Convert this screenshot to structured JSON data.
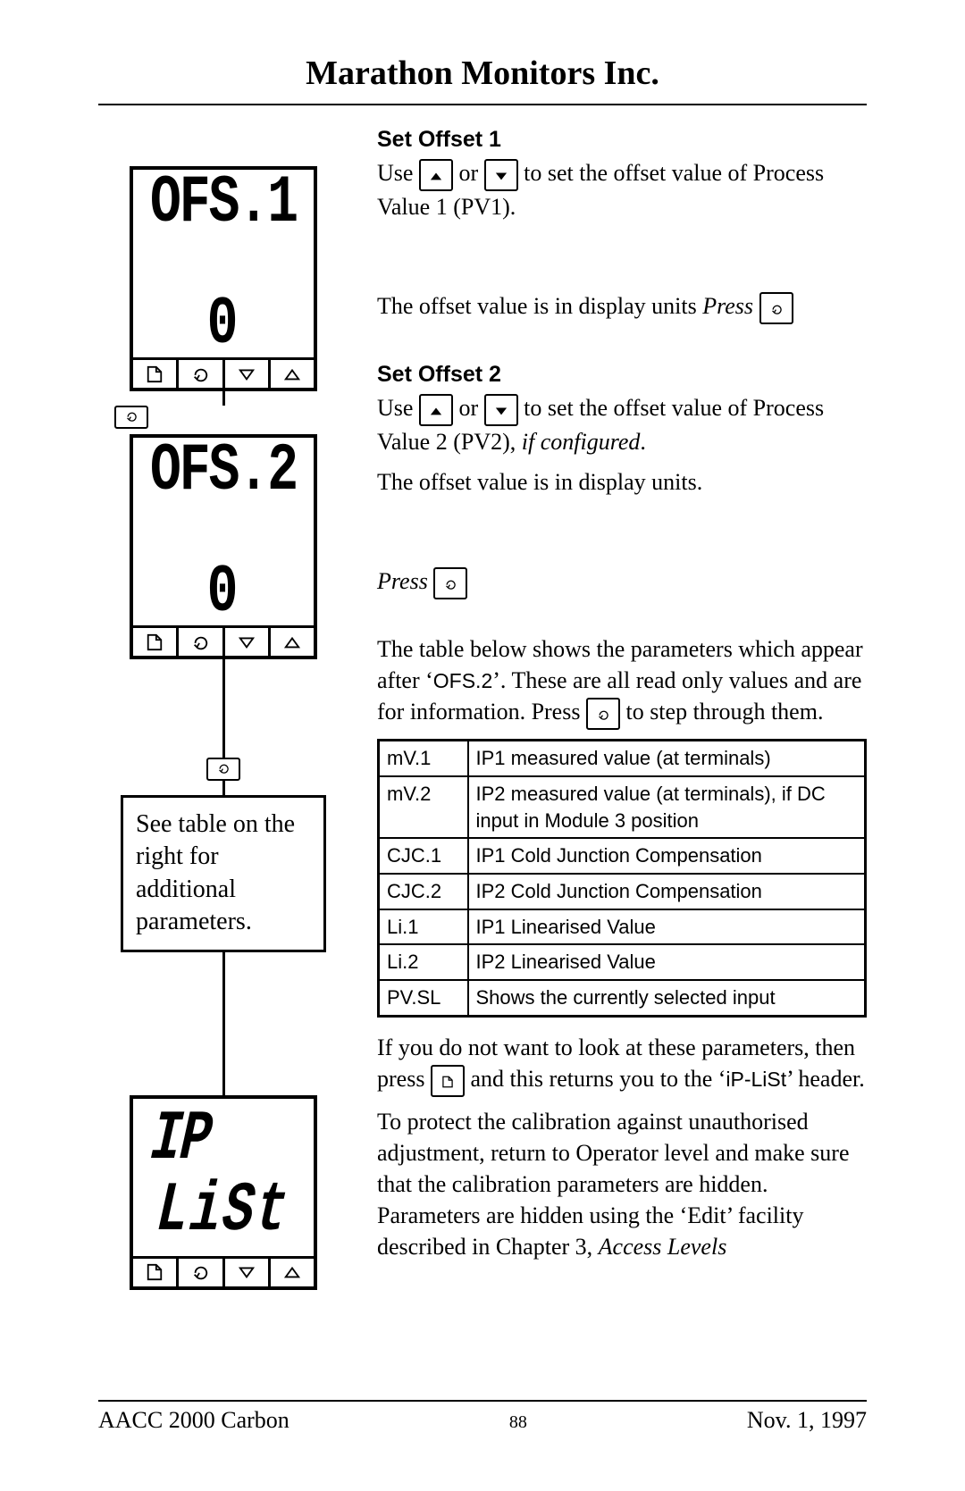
{
  "header": {
    "title": "Marathon Monitors Inc."
  },
  "lcd1": {
    "top": "OFS.1",
    "bottom": "0"
  },
  "lcd2": {
    "top": "OFS.2",
    "bottom": "0"
  },
  "lcd3": {
    "top": "IP",
    "bottom": "LiSt"
  },
  "notebox": "See table on the right for additional parameters.",
  "sections": {
    "s1_head": "Set Offset 1",
    "s1_a_pre": "Use ",
    "s1_a_mid": " or ",
    "s1_a_post": " to set the offset value of Process Value 1 (PV1).",
    "s1_b_pre": "The offset value is in display units ",
    "s1_b_press": "Press",
    "s2_head": "Set Offset 2",
    "s2_a_pre": "Use ",
    "s2_a_mid": " or ",
    "s2_a_post": " to set the offset value of Process Value 2 (PV2), ",
    "s2_a_ital": "if configured",
    "s2_a_end": ".",
    "s2_b": "The offset value is in display units.",
    "s2_press": "Press",
    "intro_a": "The table below shows the parameters which appear after ‘",
    "intro_code": "OFS.2",
    "intro_b": "’.   These are all read only values and are for information.   Press ",
    "intro_c": " to step through them.",
    "after_a": "If you do not want to look at these parameters, then press ",
    "after_b": " and this returns you to the ‘",
    "after_code": "iP-LiSt",
    "after_c": "’ header.",
    "after_d": "To protect the calibration against unauthorised adjustment, return to Operator level and make sure that the calibration parameters are hidden. Parameters are hidden using the ‘Edit’ facility described in Chapter 3, ",
    "after_ital": "Access Levels"
  },
  "table": [
    {
      "k": "mV.1",
      "v": "IP1 measured value (at terminals)"
    },
    {
      "k": "mV.2",
      "v": "IP2 measured value (at terminals), if DC input in Module 3 position"
    },
    {
      "k": "CJC.1",
      "v": "IP1 Cold Junction Compensation"
    },
    {
      "k": "CJC.2",
      "v": "IP2 Cold Junction Compensation"
    },
    {
      "k": "Li.1",
      "v": "IP1 Linearised Value"
    },
    {
      "k": "Li.2",
      "v": "IP2 Linearised Value"
    },
    {
      "k": "PV.SL",
      "v": "Shows the currently selected input"
    }
  ],
  "footer": {
    "left": "AACC 2000 Carbon",
    "page": "88",
    "right": "Nov.  1, 1997"
  }
}
